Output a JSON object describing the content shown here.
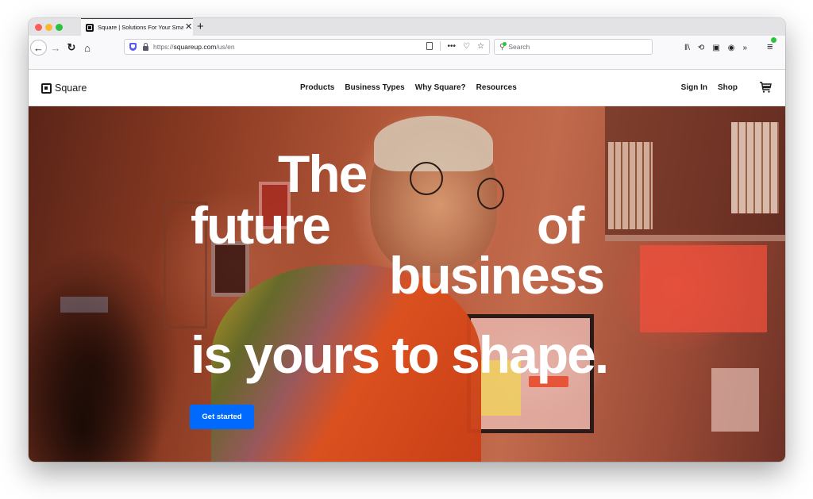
{
  "browser": {
    "tab": {
      "title": "Square | Solutions For Your Small Business",
      "favicon": "square-logo-icon"
    },
    "new_tab_label": "+",
    "toolbar": {
      "back_icon": "←",
      "forward_icon": "→",
      "reload_icon": "↻",
      "home_icon": "⌂",
      "url_scheme": "https://",
      "url_host": "squareup.com",
      "url_path": "/us/en",
      "page_actions_icon": "•••",
      "pocket_icon": "♡",
      "bookmark_icon": "☆",
      "search_placeholder": "Search",
      "library_icon": "‖\\",
      "history_icon": "⟲",
      "sidebar_icon": "▣",
      "account_icon": "◉",
      "overflow_icon": "»",
      "menu_icon": "≡"
    }
  },
  "site": {
    "logo_text": "Square",
    "nav": [
      {
        "label": "Products"
      },
      {
        "label": "Business Types"
      },
      {
        "label": "Why Square?"
      },
      {
        "label": "Resources"
      }
    ],
    "utility_nav": [
      {
        "label": "Sign In"
      },
      {
        "label": "Shop"
      }
    ],
    "cart_icon": "shopping-cart-icon",
    "hero": {
      "headline_lines": [
        "The",
        "future",
        "of",
        "business",
        "is yours to shape."
      ],
      "cta_label": "Get started",
      "cta_color": "#006aff"
    }
  }
}
